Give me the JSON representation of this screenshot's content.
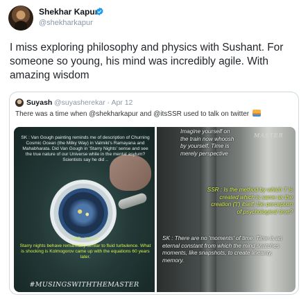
{
  "tweet": {
    "author_name": "Shekhar Kapur",
    "author_handle": "@shekharkapur",
    "verified_icon": "verified-badge-icon",
    "text": "I miss exploring philosophy and physics with Sushant. For someone so young, his mind was incredibly agile. With amazing wisdom"
  },
  "quoted": {
    "author_name": "Suyash",
    "author_handle": "@suyasherekar · Apr 12",
    "text": "There was a time when @shekharkapur and @itsSSR used to talk on twitter",
    "emoji_icon": "sunrise-emoji-icon",
    "media": {
      "left": {
        "caption_1": "SK : Van Gough painting reminds me of description of Churning Cosmic Ocean (the Milky Way) in Valmiki's Ramayana and Mahabharata. Did Van Gough in 'Starry Nights' sense and see the true nature of our Universe while in the mental asylum? Scientists say he did ..",
        "caption_2_label": "SSR : Yes sir.",
        "caption_2": "Starry nights behave remarkably similar to fluid turbulence. What is shocking is Kolmogorov came up with the equations 60 years later.",
        "hashtag": "#MUSINGSWITHTHEMASTER"
      },
      "right": {
        "watermark": "MASTER",
        "caption_1": "Imagine yourself on the train now whoosh by yourself. Time is merely perspective",
        "caption_2": "SSR : Is the method by which 'I' is created which is same as the creation ('I') itself, the perception of psychological time?",
        "caption_3": "SK : There are no 'moments' of time. Time is an eternal constant from which the mind snatches moments, like snapshots, to create linearity, memory."
      }
    }
  },
  "colors": {
    "caption_green": "#d6f050",
    "border": "#cfd9de",
    "verified_blue": "#1d9bf0"
  }
}
